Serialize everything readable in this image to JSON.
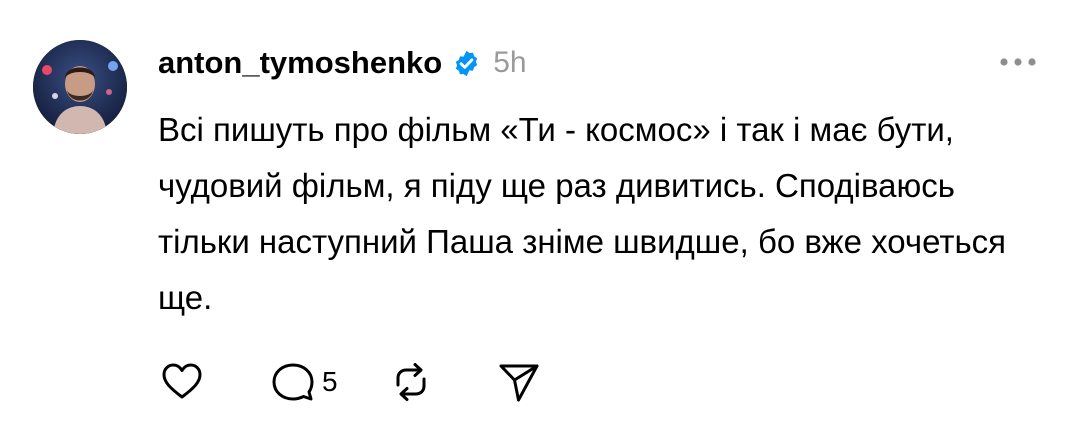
{
  "post": {
    "username": "anton_tymoshenko",
    "time": "5h",
    "text": "Всі пишуть про фільм «Ти - космос» і так і має бути, чудовий фільм, я піду ще раз дивитись. Сподіваюсь тільки наступний Паша зніме швидше, бо вже хочеться ще.",
    "replies_count": "5",
    "verified": true
  },
  "icons": {
    "verified": "verified-badge-icon",
    "more": "more-options-icon",
    "like": "heart-icon",
    "reply": "comment-icon",
    "repost": "repost-icon",
    "share": "send-icon"
  },
  "colors": {
    "verified": "#0095f6",
    "time": "#9a9a9a",
    "text": "#000000"
  }
}
